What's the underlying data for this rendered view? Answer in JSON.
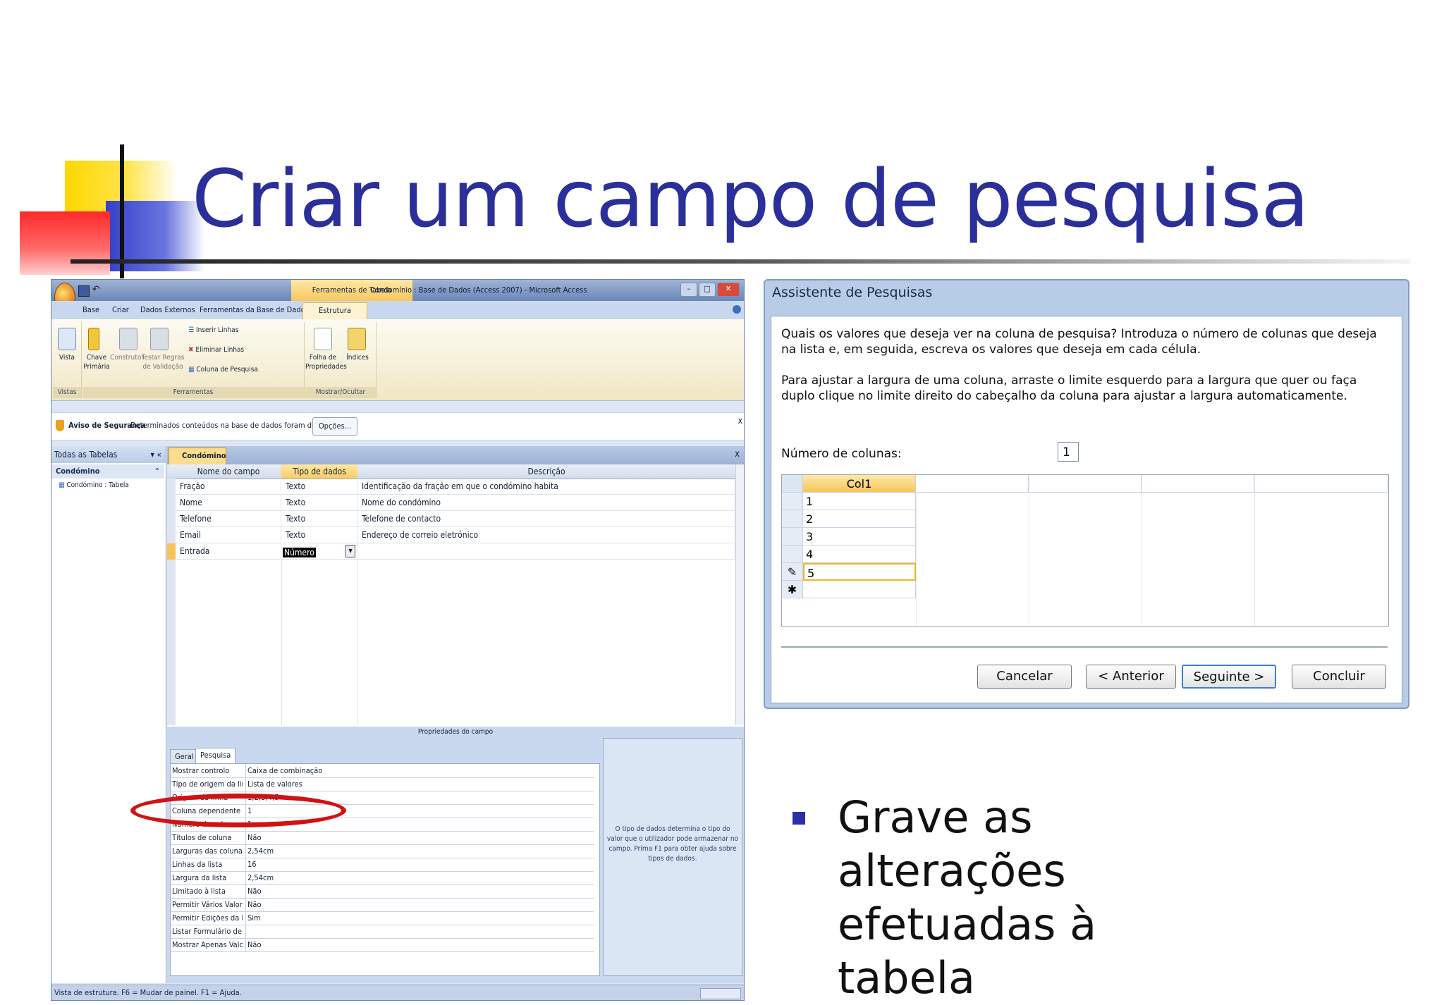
{
  "slide": {
    "title": "Criar um campo de pesquisa",
    "bullet": "Grave as alterações efetuadas à tabela"
  },
  "access": {
    "contextual_tab": "Ferramentas de Tabela",
    "window_title": "Condomínio : Base de Dados (Access 2007) - Microsoft Access",
    "menu": [
      "Base",
      "Criar",
      "Dados Externos",
      "Ferramentas da Base de Dados",
      "Estrutura"
    ],
    "ribbon": {
      "vista_label": "Vista",
      "chave_label": "Chave Primária",
      "construtor_label": "Construtor",
      "testar_label": "Testar Regras de Validação",
      "inserir_label": "Inserir Linhas",
      "eliminar_label": "Eliminar Linhas",
      "coluna_label": "Coluna de Pesquisa",
      "folha_label": "Folha de Propriedades",
      "indices_label": "Índices",
      "group_vistas": "Vistas",
      "group_ferramentas": "Ferramentas",
      "group_mostrar": "Mostrar/Ocultar"
    },
    "security": {
      "label": "Aviso de Segurança",
      "message": "Determinados conteúdos na base de dados foram desactivados",
      "button": "Opções..."
    },
    "nav": {
      "header": "Todas as Tabelas",
      "group": "Condómino",
      "item": "Condómino : Tabela"
    },
    "doc_tab": "Condómino",
    "columns": [
      "Nome do campo",
      "Tipo de dados",
      "Descrição"
    ],
    "rows": [
      {
        "name": "Fração",
        "type": "Texto",
        "desc": "Identificação da fração em que o condómino habita"
      },
      {
        "name": "Nome",
        "type": "Texto",
        "desc": "Nome do condómino"
      },
      {
        "name": "Telefone",
        "type": "Texto",
        "desc": "Telefone de contacto"
      },
      {
        "name": "Email",
        "type": "Texto",
        "desc": "Endereço de correio eletrónico"
      },
      {
        "name": "Entrada",
        "type": "Número",
        "desc": ""
      }
    ],
    "props_title": "Propriedades do campo",
    "props_tabs": [
      "Geral",
      "Pesquisa"
    ],
    "props": [
      [
        "Mostrar controlo",
        "Caixa de combinação"
      ],
      [
        "Tipo de origem da linha",
        "Lista de valores"
      ],
      [
        "Origem da linha",
        "1;2;3;4;5"
      ],
      [
        "Coluna dependente",
        "1"
      ],
      [
        "Número de colunas",
        "1"
      ],
      [
        "Títulos de coluna",
        "Não"
      ],
      [
        "Larguras das colunas",
        "2,54cm"
      ],
      [
        "Linhas da lista",
        "16"
      ],
      [
        "Largura da lista",
        "2,54cm"
      ],
      [
        "Limitado à lista",
        "Não"
      ],
      [
        "Permitir Vários Valores",
        "Não"
      ],
      [
        "Permitir Edições da Lista d",
        "Sim"
      ],
      [
        "Listar Formulário de Ediç",
        ""
      ],
      [
        "Mostrar Apenas Valores c",
        "Não"
      ]
    ],
    "help_text": "O tipo de dados determina o tipo do valor que o utilizador pode armazenar no campo. Prima F1 para obter ajuda sobre tipos de dados.",
    "status": "Vista de estrutura. F6 = Mudar de painel. F1 = Ajuda."
  },
  "wizard": {
    "title": "Assistente de Pesquisas",
    "text1": "Quais os valores que deseja ver na coluna de pesquisa? Introduza o número de colunas que deseja na lista e, em seguida, escreva os valores que deseja em cada célula.",
    "text2": "Para ajustar a largura de uma coluna, arraste o limite esquerdo para a largura que quer ou faça duplo clique no limite direito do cabeçalho da coluna para ajustar a largura automaticamente.",
    "num_cols_label": "Número de colunas:",
    "num_cols_value": "1",
    "col_header": "Col1",
    "values": [
      "1",
      "2",
      "3",
      "4",
      "5"
    ],
    "buttons": {
      "cancel": "Cancelar",
      "back": "< Anterior",
      "next": "Seguinte >",
      "finish": "Concluir"
    }
  }
}
